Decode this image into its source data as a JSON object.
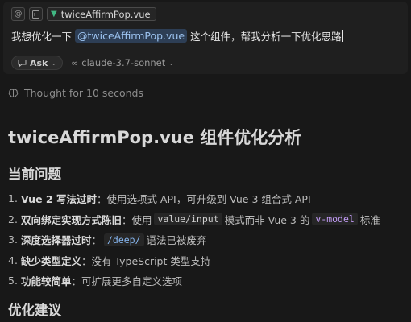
{
  "composer": {
    "context_file": "twiceAffirmPop.vue",
    "prompt_before": "我想优化一下",
    "mention": "@twiceAffirmPop.vue",
    "prompt_after": "这个组件，帮我分析一下优化思路",
    "mode_label": "Ask",
    "model_label": "claude-3.7-sonnet"
  },
  "thought_label": "Thought for 10 seconds",
  "title": "twiceAffirmPop.vue 组件优化分析",
  "section1_heading": "当前问题",
  "issues": [
    {
      "num": "1.",
      "bold": "Vue 2 写法过时",
      "text": "：使用选项式 API，可升级到 Vue 3 组合式 API"
    },
    {
      "num": "2.",
      "bold": "双向绑定实现方式陈旧",
      "pre": "：使用 ",
      "code1": "value/input",
      "mid": " 模式而非 Vue 3 的 ",
      "code2": "v-model",
      "post": " 标准"
    },
    {
      "num": "3.",
      "bold": "深度选择器过时",
      "pre": "：",
      "code": "/deep/",
      "post": " 语法已被废弃"
    },
    {
      "num": "4.",
      "bold": "缺少类型定义",
      "text": "：没有 TypeScript 类型支持"
    },
    {
      "num": "5.",
      "bold": "功能较简单",
      "text": "：可扩展更多自定义选项"
    }
  ],
  "section2_heading": "优化建议",
  "icons": {
    "mention_btn": "at-icon",
    "image_btn": "image-icon",
    "file_type": "vue-icon",
    "mode": "chat-bubble-icon",
    "model": "infinity-icon",
    "thought": "brain-icon"
  }
}
